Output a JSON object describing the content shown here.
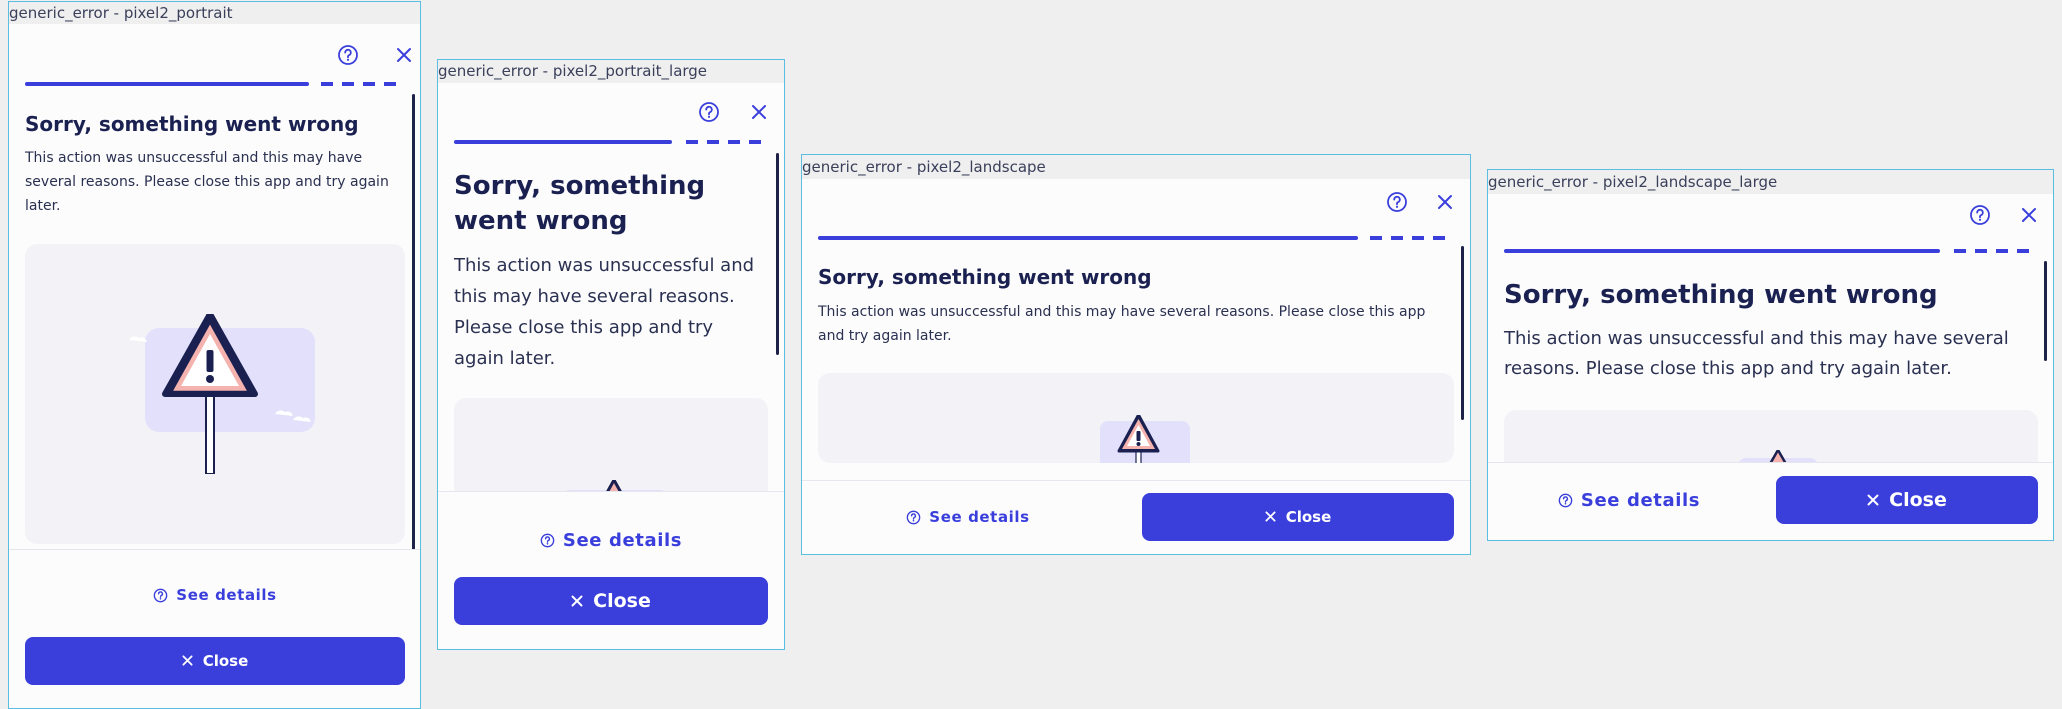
{
  "theme": {
    "accent": "#3a3fdc",
    "heading": "#1a2050",
    "frame_border": "#5bbde0",
    "canvas_background": "#efefef",
    "warning_fill": "#f4b3ae",
    "illustration_bg": "#e2e0fb"
  },
  "screen": {
    "title": "Sorry, something went wrong",
    "message": "This action was unsuccessful and this may have several reasons. Please close this app and try again later.",
    "see_details_label": "See details",
    "close_label": "Close",
    "help_icon": "question-circle-icon",
    "close_icon": "close-x-icon",
    "illustration": "warning-sign-illustration"
  },
  "frames": [
    {
      "label": "generic_error - pixel2_portrait"
    },
    {
      "label": "generic_error - pixel2_portrait_large"
    },
    {
      "label": "generic_error - pixel2_landscape"
    },
    {
      "label": "generic_error - pixel2_landscape_large"
    }
  ]
}
